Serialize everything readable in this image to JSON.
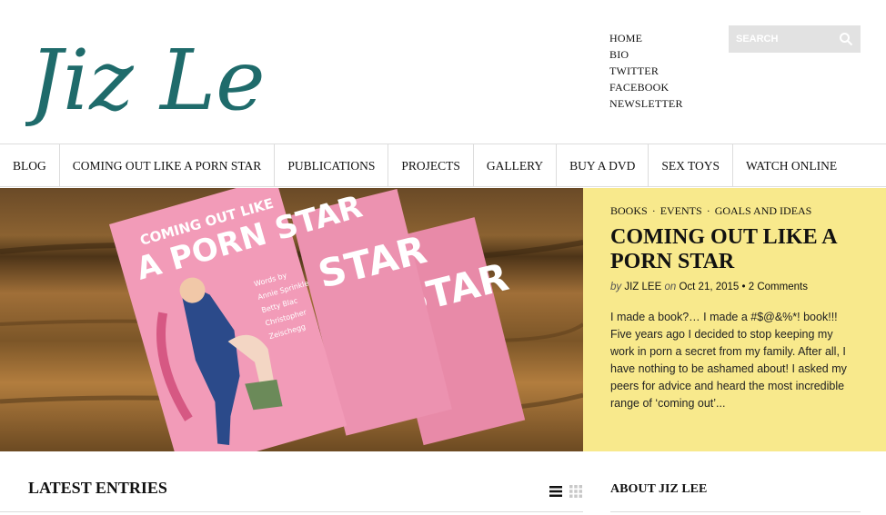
{
  "brand": {
    "logo_text": "Jiz Lee",
    "logo_color": "#1f6b6b"
  },
  "top_nav": [
    "HOME",
    "BIO",
    "TWITTER",
    "FACEBOOK",
    "NEWSLETTER"
  ],
  "search": {
    "placeholder": "SEARCH",
    "icon": "search-icon"
  },
  "main_nav": [
    "BLOG",
    "COMING OUT LIKE A PORN STAR",
    "PUBLICATIONS",
    "PROJECTS",
    "GALLERY",
    "BUY A DVD",
    "SEX TOYS",
    "WATCH ONLINE"
  ],
  "hero": {
    "categories": [
      "BOOKS",
      "EVENTS",
      "GOALS AND IDEAS"
    ],
    "title": "COMING OUT LIKE A PORN STAR",
    "meta": {
      "by": "by",
      "author": "JIZ LEE",
      "on": "on",
      "date": "Oct 21, 2015",
      "separator": "•",
      "comments": "2 Comments"
    },
    "excerpt": "I made a book?… I made a #$@&%*! book!!! Five years ago I decided to stop keeping my work in porn a secret from my family. After all, I have nothing to be ashamed about! I asked my peers for advice and heard the most incredible range of ‘coming out’...",
    "image_text": {
      "coming_out_like": "COMING OUT LIKE",
      "porn_star": "A PORN STAR",
      "star": "STAR"
    },
    "panel_color": "#f8e98c"
  },
  "latest": {
    "heading": "LATEST ENTRIES",
    "icons": [
      "list-view-icon",
      "grid-view-icon"
    ]
  },
  "sidebar": {
    "about_heading": "ABOUT JIZ LEE"
  }
}
